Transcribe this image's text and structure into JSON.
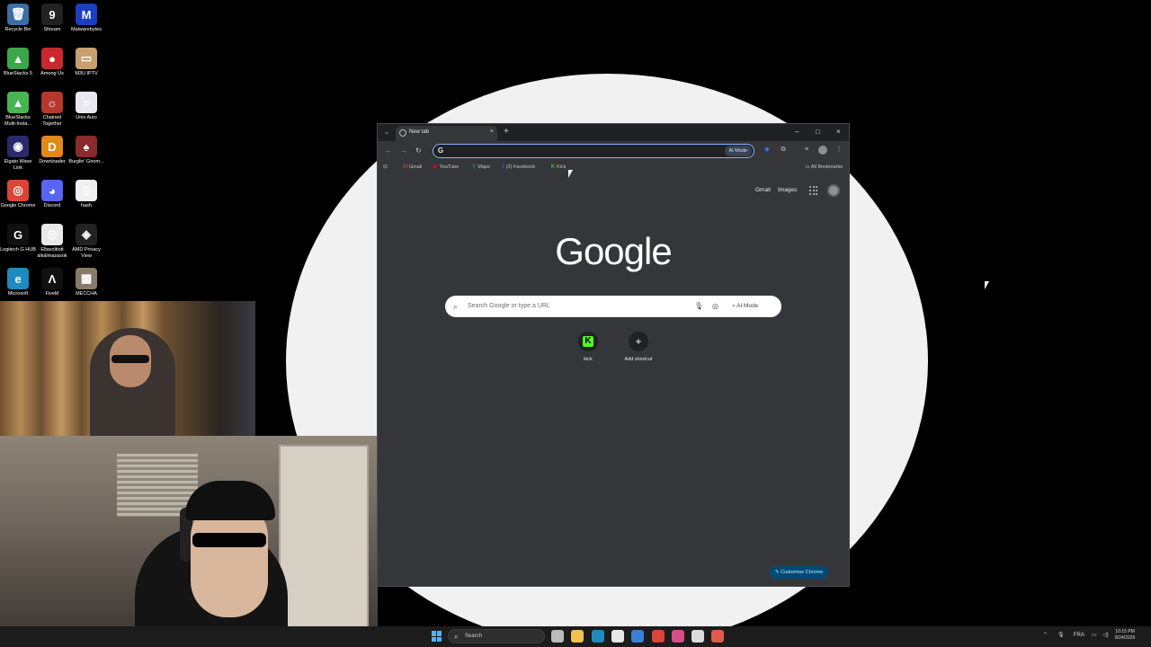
{
  "desktop": {
    "icons": [
      {
        "label": "Recycle Bin",
        "icon": "recycle-bin-icon",
        "glyph": "🗑",
        "color": "#3a6ea5"
      },
      {
        "label": "Sltream",
        "icon": "sltream-icon",
        "glyph": "9",
        "color": "#222222"
      },
      {
        "label": "Malwarebytes",
        "icon": "malwarebytes-icon",
        "glyph": "M",
        "color": "#1a3fbf"
      },
      {
        "label": "BlueStacks 5",
        "icon": "bluestacks-icon",
        "glyph": "▲",
        "color": "#3aa84a"
      },
      {
        "label": "Among Us",
        "icon": "among-us-icon",
        "glyph": "●",
        "color": "#c9282d"
      },
      {
        "label": "M3U IPTV",
        "icon": "m3u-iptv-icon",
        "glyph": "▭",
        "color": "#c8a070"
      },
      {
        "label": "BlueStacks Multi-Insta...",
        "icon": "bluestacks-multi-icon",
        "glyph": "▲",
        "color": "#48b552"
      },
      {
        "label": "Chained Together",
        "icon": "chained-together-icon",
        "glyph": "☼",
        "color": "#b33a2a"
      },
      {
        "label": "Unis Auto",
        "icon": "unis-auto-icon",
        "glyph": "≡",
        "color": "#e8e8f0"
      },
      {
        "label": "Elgato Wave Link",
        "icon": "elgato-wave-link-icon",
        "glyph": "◉",
        "color": "#2a2a6a"
      },
      {
        "label": "Downloader",
        "icon": "downloader-icon",
        "glyph": "D",
        "color": "#e08a1a"
      },
      {
        "label": "Burglin' Gnom...",
        "icon": "burglin-gnomes-icon",
        "glyph": "♠",
        "color": "#8a2a2a"
      },
      {
        "label": "Google Chrome",
        "icon": "chrome-icon",
        "glyph": "◎",
        "color": "#db4437"
      },
      {
        "label": "Discord",
        "icon": "discord-icon",
        "glyph": "◕",
        "color": "#5865f2"
      },
      {
        "label": "hash",
        "icon": "file-icon",
        "glyph": "▯",
        "color": "#f0f0f0"
      },
      {
        "label": "Logitech G HUB",
        "icon": "logitech-g-hub-icon",
        "glyph": "G",
        "color": "#111111"
      },
      {
        "label": "Eltavolitott alkalmazasok",
        "icon": "chrome-shortcut-icon",
        "glyph": "◎",
        "color": "#e9e9e9"
      },
      {
        "label": "AMD Privacy View",
        "icon": "amd-privacy-view-icon",
        "glyph": "◈",
        "color": "#222222"
      },
      {
        "label": "Microsoft",
        "icon": "edge-icon",
        "glyph": "e",
        "color": "#1f8ac0"
      },
      {
        "label": "FiveM",
        "icon": "fivem-icon",
        "glyph": "Λ",
        "color": "#111111"
      },
      {
        "label": "MECCHA",
        "icon": "meccha-icon",
        "glyph": "▩",
        "color": "#8a7a6a"
      }
    ]
  },
  "browser": {
    "tab_title": "New tab",
    "new_tab": "+",
    "tab_close": "×",
    "window_controls": {
      "minimize": "–",
      "maximize": "□",
      "close": "×"
    },
    "toolbar": {
      "back": "←",
      "forward": "→",
      "reload": "↻"
    },
    "omnibox": {
      "value": "",
      "placeholder": "",
      "ai_mode": "AI Mode"
    },
    "bookmarks": [
      {
        "label": "Gmail",
        "glyph": "M",
        "color": "#ea4335"
      },
      {
        "label": "YouTube",
        "glyph": "▶",
        "color": "#ff0000"
      },
      {
        "label": "Maps",
        "glyph": "⚲",
        "color": "#34a853"
      },
      {
        "label": "(2) Facebook",
        "glyph": "f",
        "color": "#1877f2"
      },
      {
        "label": "Kick",
        "glyph": "K",
        "color": "#53fc18"
      }
    ],
    "all_bookmarks": "All Bookmarks",
    "ntp": {
      "gmail": "Gmail",
      "images": "Images",
      "logo": "Google",
      "search_placeholder": "Search Google or type a URL",
      "ai_mode": "AI Mode",
      "shortcuts": [
        {
          "label": "kick"
        },
        {
          "label": "Add shortcut"
        }
      ],
      "customise": "Customise Chrome"
    }
  },
  "taskbar": {
    "search_label": "Search",
    "apps": [
      {
        "icon": "task-view-icon",
        "color": "#bbbbbb"
      },
      {
        "icon": "file-explorer-icon",
        "color": "#f2c14e"
      },
      {
        "icon": "edge-icon",
        "color": "#1f8ac0"
      },
      {
        "icon": "store-icon",
        "color": "#e8e8e8"
      },
      {
        "icon": "outlook-icon",
        "color": "#3b7fd6"
      },
      {
        "icon": "chrome-icon",
        "color": "#db4437"
      },
      {
        "icon": "app-icon",
        "color": "#d94c8a"
      },
      {
        "icon": "obs-icon",
        "color": "#dddddd"
      },
      {
        "icon": "chrome-icon",
        "color": "#e05a4a"
      }
    ],
    "tray_lang": "FRA",
    "clock_time": "10:15 PM",
    "clock_date": "8/24/2026"
  }
}
